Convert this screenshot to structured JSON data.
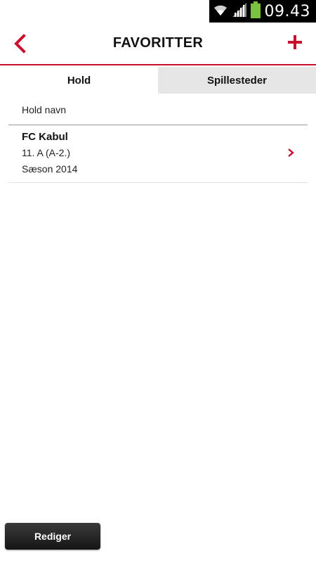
{
  "status_bar": {
    "time": "09.43",
    "icons": [
      "wifi-icon",
      "signal-icon",
      "battery-icon"
    ],
    "battery_color": "#7cc242"
  },
  "header": {
    "title": "FAVORITTER",
    "back_icon": "chevron-left-icon",
    "add_icon": "plus-icon",
    "accent_color": "#c8102e"
  },
  "tabs": [
    {
      "label": "Hold",
      "active": true
    },
    {
      "label": "Spillesteder",
      "active": false
    }
  ],
  "list": {
    "column_header": "Hold navn",
    "items": [
      {
        "name": "FC Kabul",
        "line2": "11. A (A-2.)",
        "line3": "Sæson 2014"
      }
    ]
  },
  "footer": {
    "edit_label": "Rediger"
  }
}
